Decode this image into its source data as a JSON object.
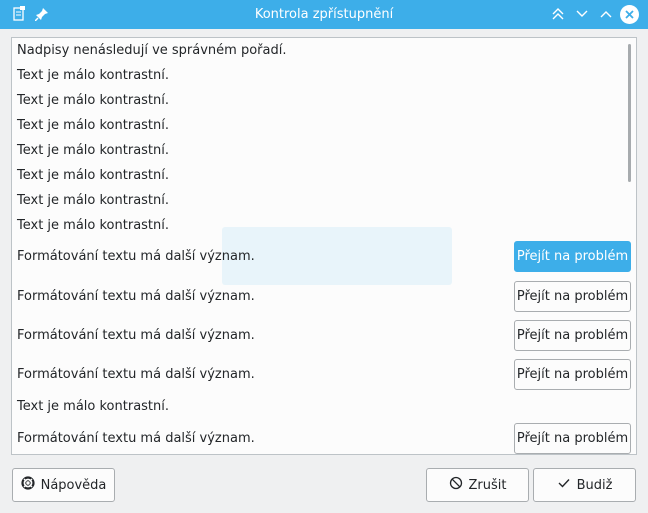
{
  "window": {
    "title": "Kontrola zpřístupnění",
    "app_icon": "document-icon",
    "pin_icon": "pin-icon",
    "controls": [
      "keep-above-icon",
      "keep-below-icon",
      "maximize-icon",
      "close-icon"
    ]
  },
  "issues": [
    {
      "text": "Nadpisy nenásledují ve správném pořadí."
    },
    {
      "text": "Text je málo kontrastní."
    },
    {
      "text": "Text je málo kontrastní."
    },
    {
      "text": "Text je málo kontrastní."
    },
    {
      "text": "Text je málo kontrastní."
    },
    {
      "text": "Text je málo kontrastní."
    },
    {
      "text": "Text je málo kontrastní."
    },
    {
      "text": "Text je málo kontrastní."
    },
    {
      "text": "Formátování textu má další význam.",
      "button": "Přejít na problém"
    },
    {
      "text": "Formátování textu má další význam.",
      "button": "Přejít na problém"
    },
    {
      "text": "Formátování textu má další význam.",
      "button": "Přejít na problém"
    },
    {
      "text": "Formátování textu má další význam.",
      "button": "Přejít na problém"
    },
    {
      "text": "Text je málo kontrastní."
    },
    {
      "text": "Formátování textu má další význam.",
      "button": "Přejít na problém"
    }
  ],
  "footer": {
    "help_label": "Nápověda",
    "help_icon": "lifebuoy-icon",
    "cancel_label": "Zrušit",
    "cancel_icon": "cancel-icon",
    "ok_label": "Budiž",
    "ok_icon": "checkmark-icon"
  },
  "colors": {
    "accent": "#3daee9",
    "background": "#eff0f1",
    "panel": "#fcfcfc"
  }
}
